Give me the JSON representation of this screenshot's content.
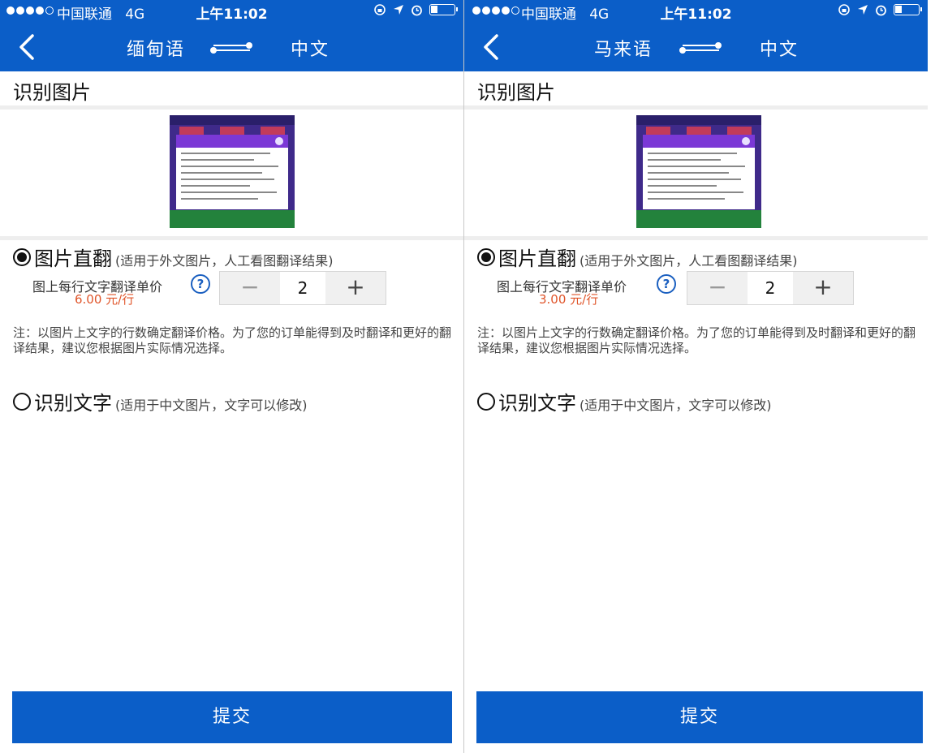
{
  "status": {
    "carrier": "中国联通",
    "network": "4G",
    "time": "上午11:02"
  },
  "colors": {
    "brand": "#0b5ec8",
    "price": "#e0552a",
    "help": "#1a5fc0"
  },
  "screens": [
    {
      "nav": {
        "source_lang": "缅甸语",
        "target_lang": "中文"
      },
      "section_title": "识别图片",
      "option_direct": {
        "label": "图片直翻",
        "hint": "(适用于外文图片，人工看图翻译结果)",
        "selected": true
      },
      "price": {
        "label": "图上每行文字翻译单价",
        "value": "6.00 元/行"
      },
      "help_icon": "?",
      "stepper": {
        "minus": "−",
        "value": "2",
        "plus": "+"
      },
      "note": "注：以图片上文字的行数确定翻译价格。为了您的订单能得到及时翻译和更好的翻译结果，建议您根据图片实际情况选择。",
      "option_ocr": {
        "label": "识别文字",
        "hint": "(适用于中文图片，文字可以修改)",
        "selected": false
      },
      "submit_label": "提交"
    },
    {
      "nav": {
        "source_lang": "马来语",
        "target_lang": "中文"
      },
      "section_title": "识别图片",
      "option_direct": {
        "label": "图片直翻",
        "hint": "(适用于外文图片，人工看图翻译结果)",
        "selected": true
      },
      "price": {
        "label": "图上每行文字翻译单价",
        "value": "3.00 元/行"
      },
      "help_icon": "?",
      "stepper": {
        "minus": "−",
        "value": "2",
        "plus": "+"
      },
      "note": "注：以图片上文字的行数确定翻译价格。为了您的订单能得到及时翻译和更好的翻译结果，建议您根据图片实际情况选择。",
      "option_ocr": {
        "label": "识别文字",
        "hint": "(适用于中文图片，文字可以修改)",
        "selected": false
      },
      "submit_label": "提交"
    }
  ]
}
